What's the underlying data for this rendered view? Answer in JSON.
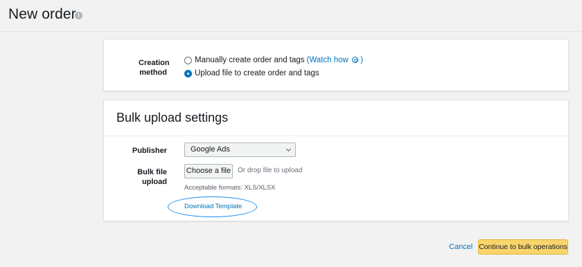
{
  "header": {
    "title": "New order"
  },
  "creation": {
    "label_line1": "Creation",
    "label_line2": "method",
    "option_manual": "Manually create order and tags",
    "watch_how": "(Watch how",
    "watch_how_close": ")",
    "option_upload": "Upload file to create order and tags",
    "selected": "upload"
  },
  "bulk": {
    "title": "Bulk upload settings",
    "publisher_label": "Publisher",
    "publisher_value": "Google Ads",
    "file_label": "Bulk file upload",
    "choose_file": "Choose a file",
    "drop_text": "Or drop file to upload",
    "formats": "Acceptable formats: XLS/XLSX",
    "download_template": "Download Template"
  },
  "footer": {
    "cancel": "Cancel",
    "continue": "Continue to bulk operations"
  },
  "colors": {
    "link": "#0073bb",
    "primary_button": "#f9d56c",
    "highlight_ellipse": "#1a8ff0"
  }
}
